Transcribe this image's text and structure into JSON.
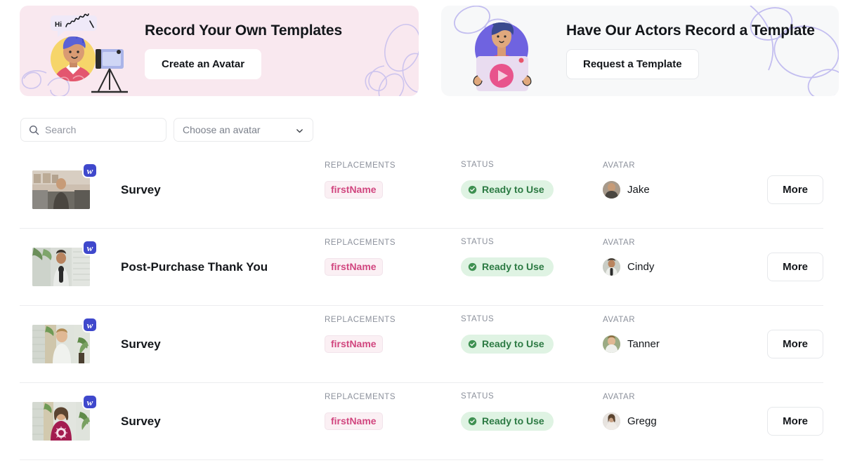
{
  "banners": [
    {
      "id": "record-own",
      "title": "Record Your Own Templates",
      "button": "Create an Avatar",
      "bg": "#f9e8ef",
      "art": "avatar-recording-illustration",
      "speech_bubble": "Hi"
    },
    {
      "id": "actors-record",
      "title": "Have Our Actors Record a Template",
      "button": "Request a Template",
      "bg": "#f7f8f9",
      "art": "actor-video-illustration"
    }
  ],
  "filters": {
    "search": {
      "value": "",
      "placeholder": "Search",
      "icon": "search-icon"
    },
    "avatar_select": {
      "value": "Choose an avatar",
      "icon": "chevron-down-icon"
    }
  },
  "columns": {
    "replacements": "REPLACEMENTS",
    "status": "STATUS",
    "avatar": "AVATAR"
  },
  "more_label": "More",
  "rows": [
    {
      "name": "Survey",
      "replacement": "firstName",
      "status": "Ready to Use",
      "avatar_name": "Jake",
      "badge": "w",
      "thumb_colors": [
        "#cdbfb0",
        "#6d6a63",
        "#4a4640"
      ],
      "avatar_colors": [
        "#6b5f52",
        "#3d3a36"
      ]
    },
    {
      "name": "Post-Purchase Thank You",
      "replacement": "firstName",
      "status": "Ready to Use",
      "avatar_name": "Cindy",
      "badge": "w",
      "thumb_colors": [
        "#d8dcd6",
        "#9aa096",
        "#5d6257"
      ],
      "avatar_colors": [
        "#c9cdc6",
        "#4b4f48"
      ]
    },
    {
      "name": "Survey",
      "replacement": "firstName",
      "status": "Ready to Use",
      "avatar_name": "Tanner",
      "badge": "w",
      "thumb_colors": [
        "#dfe3dc",
        "#a8b39c",
        "#7d8b6e"
      ],
      "avatar_colors": [
        "#b6c0a8",
        "#5d6a50"
      ]
    },
    {
      "name": "Survey",
      "replacement": "firstName",
      "status": "Ready to Use",
      "avatar_name": "Gregg",
      "badge": "w",
      "thumb_colors": [
        "#e2e5df",
        "#a31c50",
        "#7c1a3e"
      ],
      "avatar_colors": [
        "#e4e0dc",
        "#8a7f76"
      ]
    }
  ],
  "colors": {
    "status_text": "#2c7a43",
    "status_bg": "#dff3e3",
    "replacement_text": "#d1467f",
    "replacement_bg": "#fbf0f4",
    "badge_blue": "#3f48cc",
    "banner_pink": "#f9e8ef",
    "banner_grey": "#f7f8f9",
    "swirl": "#bdb7ef"
  }
}
